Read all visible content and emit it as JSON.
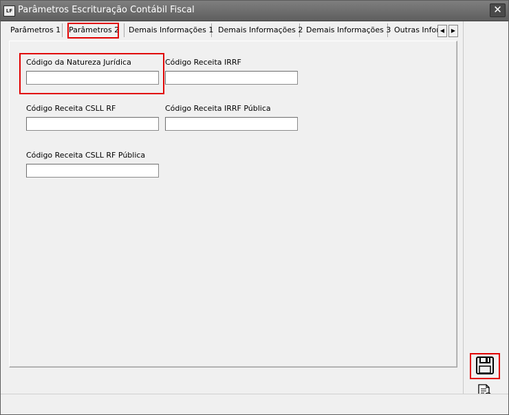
{
  "window": {
    "app_icon_text": "LF",
    "title": "Parâmetros Escrituração Contábil Fiscal",
    "close_symbol": "✕"
  },
  "tabs": [
    {
      "label": "Parâmetros 1",
      "active": false
    },
    {
      "label": "Parâmetros 2",
      "active": true
    },
    {
      "label": "Demais Informações 1",
      "active": false
    },
    {
      "label": "Demais Informações 2",
      "active": false
    },
    {
      "label": "Demais Informações 3",
      "active": false
    },
    {
      "label": "Outras Infor",
      "active": false
    }
  ],
  "tab_scroll": {
    "left": "◀",
    "right": "▶"
  },
  "fields": {
    "natureza_juridica": {
      "label": "Código da Natureza Jurídica",
      "value": ""
    },
    "receita_irrf": {
      "label": "Código Receita IRRF",
      "value": ""
    },
    "receita_csll_rf": {
      "label": "Código Receita CSLL RF",
      "value": ""
    },
    "receita_irrf_publica": {
      "label": "Código Receita IRRF Pública",
      "value": ""
    },
    "receita_csll_rf_publica": {
      "label": "Código Receita CSLL RF Pública",
      "value": ""
    }
  },
  "colors": {
    "highlight": "#e10000",
    "titlebar": "#6b6b6b"
  },
  "icons": {
    "save": "save-icon",
    "cancel": "cancel-document-icon"
  }
}
